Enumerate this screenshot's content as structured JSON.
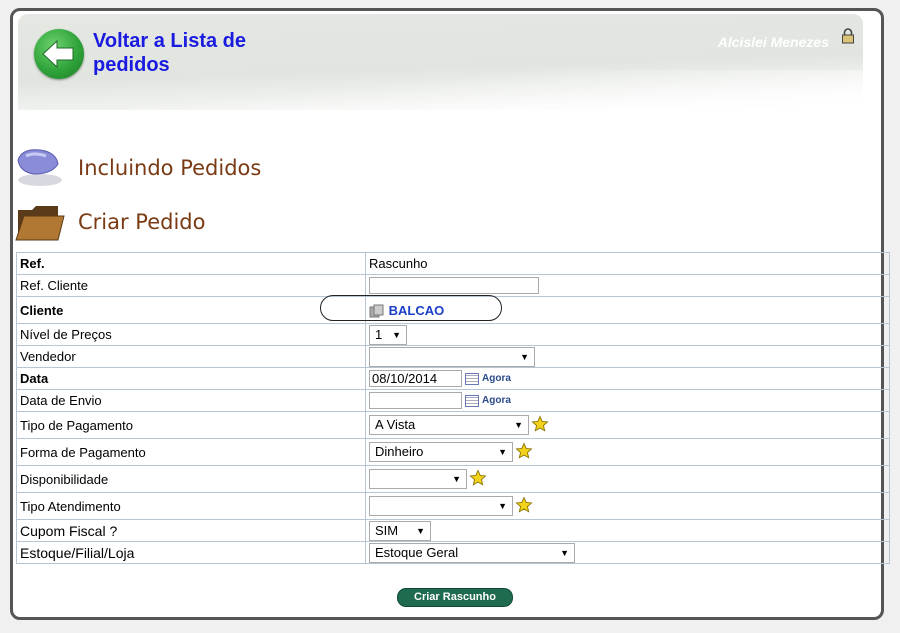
{
  "header": {
    "back_link": "Voltar a Lista de pedidos",
    "user_name": "Alcislei Menezes"
  },
  "sections": {
    "including": "Incluindo Pedidos",
    "create": "Criar Pedido"
  },
  "form": {
    "ref_label": "Ref.",
    "ref_value": "Rascunho",
    "ref_cliente_label": "Ref. Cliente",
    "ref_cliente_value": "",
    "cliente_label": "Cliente",
    "cliente_value": "BALCAO",
    "nivel_label": "Nível de Preços",
    "nivel_value": "1",
    "vendedor_label": "Vendedor",
    "vendedor_value": "",
    "data_label": "Data",
    "data_value": "08/10/2014",
    "data_now": "Agora",
    "envio_label": "Data de Envio",
    "envio_value": "",
    "envio_now": "Agora",
    "tipo_pag_label": "Tipo de Pagamento",
    "tipo_pag_value": "A Vista",
    "forma_pag_label": "Forma de Pagamento",
    "forma_pag_value": "Dinheiro",
    "disp_label": "Disponibilidade",
    "disp_value": "",
    "atend_label": "Tipo Atendimento",
    "atend_value": "",
    "cupom_label": "Cupom Fiscal ?",
    "cupom_value": "SIM",
    "estoque_label": "Estoque/Filial/Loja",
    "estoque_value": "Estoque Geral"
  },
  "actions": {
    "create_draft": "Criar Rascunho"
  },
  "colors": {
    "link": "#1a1ae0",
    "section_title": "#7a3b14",
    "button_bg": "#1f6b4f"
  }
}
